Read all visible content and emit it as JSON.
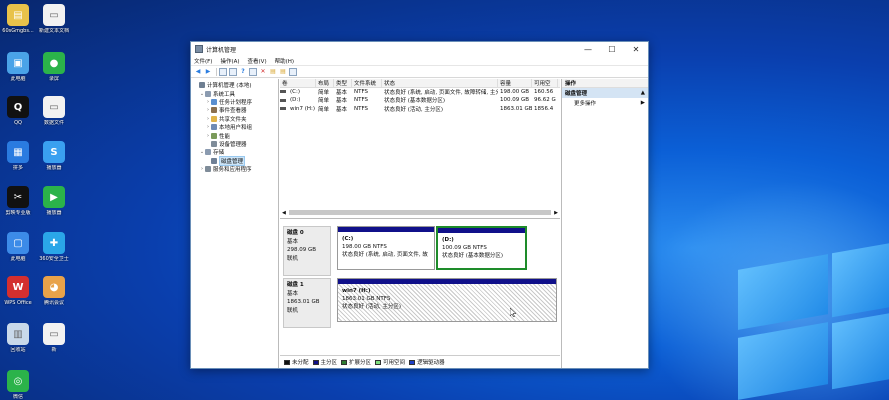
{
  "window": {
    "title": "计算机管理",
    "minimize_label": "—",
    "maximize_label": "☐",
    "close_label": "✕"
  },
  "menu": [
    "文件(F)",
    "操作(A)",
    "查看(V)",
    "帮助(H)"
  ],
  "toolbar_icons": [
    "back-icon",
    "forward-icon",
    "up-icon",
    "properties-icon",
    "help-icon",
    "list-icon",
    "delete-icon",
    "refresh-icon",
    "export-icon",
    "settings-icon"
  ],
  "tree": [
    {
      "label": "计算机管理 (本地)",
      "indent": 0,
      "expander": "",
      "color": "#6f7f92"
    },
    {
      "label": "系统工具",
      "indent": 1,
      "expander": "⌄",
      "color": "#8b9bb0"
    },
    {
      "label": "任务计划程序",
      "indent": 2,
      "expander": "›",
      "color": "#5a8fd0"
    },
    {
      "label": "事件查看器",
      "indent": 2,
      "expander": "›",
      "color": "#8a6f4f"
    },
    {
      "label": "共享文件夹",
      "indent": 2,
      "expander": "›",
      "color": "#e0b44a"
    },
    {
      "label": "本地用户和组",
      "indent": 2,
      "expander": "›",
      "color": "#6f8bb5"
    },
    {
      "label": "性能",
      "indent": 2,
      "expander": "›",
      "color": "#7a9a5a"
    },
    {
      "label": "设备管理器",
      "indent": 2,
      "expander": "",
      "color": "#7f8c99"
    },
    {
      "label": "存储",
      "indent": 1,
      "expander": "⌄",
      "color": "#8b9bb0"
    },
    {
      "label": "磁盘管理",
      "indent": 2,
      "expander": "",
      "color": "#6f8096",
      "selected": true
    },
    {
      "label": "服务和应用程序",
      "indent": 1,
      "expander": "›",
      "color": "#7f8c99"
    }
  ],
  "volume_table": {
    "headers": [
      "卷",
      "布局",
      "类型",
      "文件系统",
      "状态",
      "容量",
      "可用空"
    ],
    "rows": [
      [
        "(C:)",
        "简单",
        "基本",
        "NTFS",
        "状态良好 (系统, 启动, 页面文件, 故障转储, 主分区)",
        "198.00 GB",
        "160.56"
      ],
      [
        "(D:)",
        "简单",
        "基本",
        "NTFS",
        "状态良好 (基本数据分区)",
        "100.09 GB",
        "96.62 G"
      ],
      [
        "win7 (H:)",
        "简单",
        "基本",
        "NTFS",
        "状态良好 (活动, 主分区)",
        "1863.01 GB",
        "1856.4"
      ]
    ]
  },
  "disks": [
    {
      "name": "磁盘 0",
      "type": "基本",
      "size": "298.09 GB",
      "status": "联机",
      "partitions": [
        {
          "name": "(C:)",
          "size": "198.00 GB NTFS",
          "status": "状态良好 (系统, 启动, 页面文件, 故",
          "selected": false
        },
        {
          "name": "(D:)",
          "size": "100.09 GB NTFS",
          "status": "状态良好 (基本数据分区)",
          "selected": true
        }
      ]
    },
    {
      "name": "磁盘 1",
      "type": "基本",
      "size": "1863.01 GB",
      "status": "联机",
      "partitions": [
        {
          "name": "win7 (H:)",
          "size": "1863.01 GB NTFS",
          "status": "状态良好 (活动, 主分区)",
          "selected": false
        }
      ]
    }
  ],
  "legend": [
    {
      "label": "未分配",
      "color": "#111111"
    },
    {
      "label": "主分区",
      "color": "#10108a"
    },
    {
      "label": "扩展分区",
      "color": "#2e7d32"
    },
    {
      "label": "可用空间",
      "color": "#7ee07e"
    },
    {
      "label": "逻辑驱动器",
      "color": "#1e40c8"
    }
  ],
  "actions": {
    "header": "操作",
    "section": "磁盘管理",
    "item": "更多操作"
  },
  "desktop_icons": [
    {
      "label": "60sGmgbs...",
      "color": "#e8c24a",
      "glyph": "▤"
    },
    {
      "label": "新建文本文档",
      "color": "#f2f2f2",
      "glyph": "▭"
    },
    {
      "label": "此电脑",
      "color": "#4aa3e8",
      "glyph": "▣"
    },
    {
      "label": "录屏",
      "color": "#2bb34a",
      "glyph": "●"
    },
    {
      "label": "QQ",
      "color": "#111111",
      "glyph": "Q"
    },
    {
      "label": "数据文件",
      "color": "#f2f2f2",
      "glyph": "▭"
    },
    {
      "label": "拼多",
      "color": "#2a7be0",
      "glyph": "▦"
    },
    {
      "label": "播放器",
      "color": "#3aa0f0",
      "glyph": "S"
    },
    {
      "label": "剪映专业版",
      "color": "#111111",
      "glyph": "✂"
    },
    {
      "label": "播放器",
      "color": "#2bb34a",
      "glyph": "▶"
    },
    {
      "label": "此电脑",
      "color": "#3c8be8",
      "glyph": "▢"
    },
    {
      "label": "360安全卫士",
      "color": "#2aa6e8",
      "glyph": "✚"
    },
    {
      "label": "WPS Office",
      "color": "#d32f2f",
      "glyph": "W"
    },
    {
      "label": "腾讯会议",
      "color": "#e8a24a",
      "glyph": "◕"
    },
    {
      "label": "回收站",
      "color": "#c9d9ea",
      "glyph": "▥"
    },
    {
      "label": "新",
      "color": "#f2f2f2",
      "glyph": "▭"
    },
    {
      "label": "微信",
      "color": "#2bb34a",
      "glyph": "◎"
    }
  ]
}
